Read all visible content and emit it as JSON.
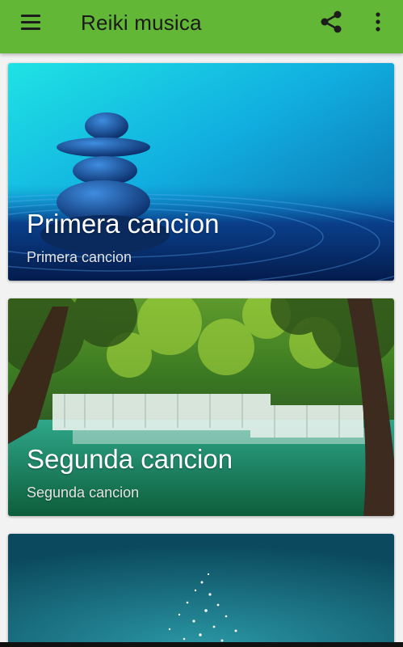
{
  "app_bar": {
    "title": "Reiki musica",
    "color": "#62b736",
    "menu_icon": "hamburger-menu-icon",
    "share_icon": "share-icon",
    "more_icon": "more-vert-icon"
  },
  "songs": [
    {
      "title": "Primera cancion",
      "subtitle": "Primera cancion",
      "image": "zen-stones-on-water"
    },
    {
      "title": "Segunda cancion",
      "subtitle": "Segunda cancion",
      "image": "forest-waterfall"
    },
    {
      "title": "",
      "subtitle": "",
      "image": "teal-sparkles"
    }
  ]
}
